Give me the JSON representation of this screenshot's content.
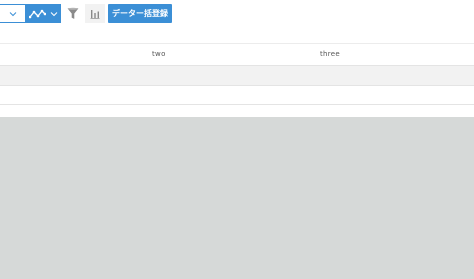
{
  "toolbar": {
    "view_select_icon": "chevron-down-icon",
    "chart_type_icon": "line-chart-icon",
    "filter_icon": "funnel-icon",
    "graph_icon": "bar-chart-icon",
    "register_button_label": "データー括登録",
    "accent_color": "#3b8fd6"
  },
  "table": {
    "columns": [
      "",
      "two",
      "three"
    ],
    "rows": [
      [
        "",
        "",
        ""
      ],
      [
        "",
        "",
        ""
      ],
      [
        "",
        "",
        ""
      ]
    ]
  },
  "colors": {
    "empty_area": "#d6d9d8",
    "row_stripe": "#f2f2f2"
  }
}
